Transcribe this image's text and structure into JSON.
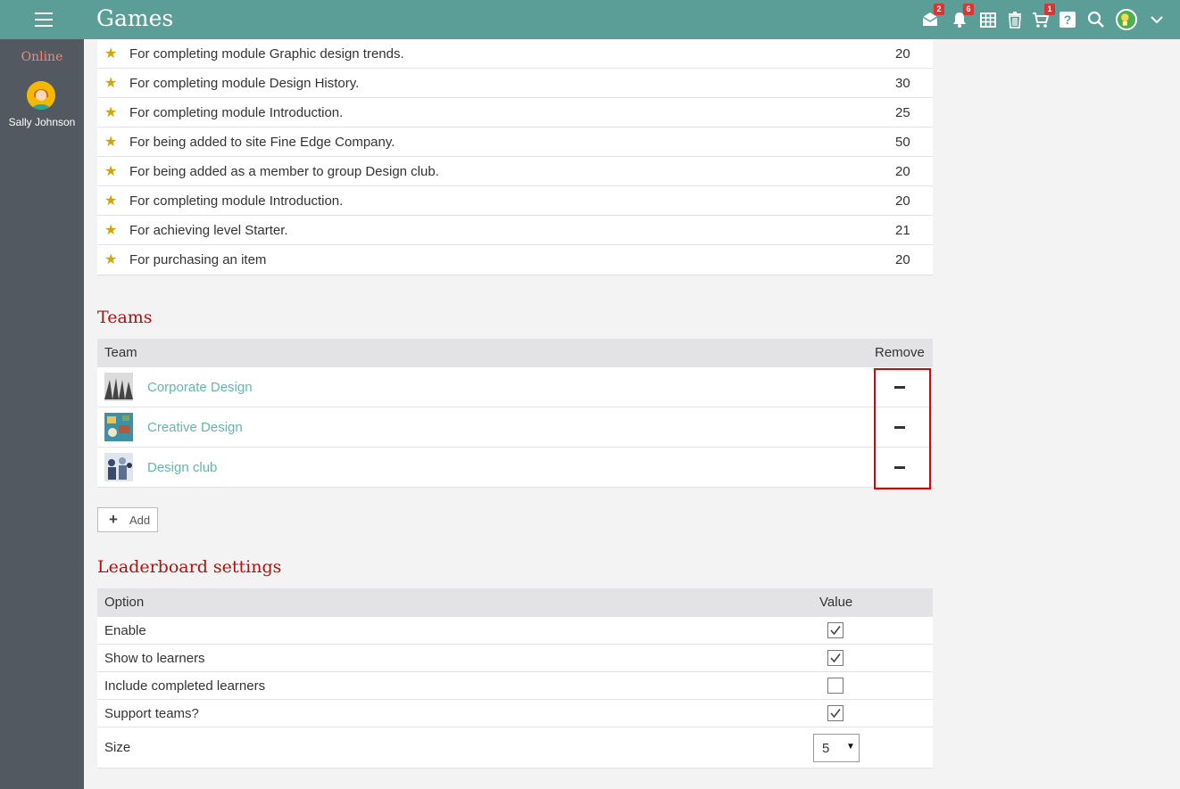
{
  "header": {
    "title": "Games",
    "badges": {
      "messages": "2",
      "notifications": "6",
      "cart": "1"
    },
    "icons": [
      "menu-icon",
      "messages-icon",
      "notifications-icon",
      "calendar-icon",
      "trash-icon",
      "cart-icon",
      "help-icon",
      "search-icon",
      "user-avatar",
      "chevron-down-icon"
    ]
  },
  "sidebar": {
    "status": "Online",
    "user_name": "Sally Johnson"
  },
  "points": [
    {
      "description": "For completing module Graphic design trends.",
      "value": "20"
    },
    {
      "description": "For completing module Design History.",
      "value": "30"
    },
    {
      "description": "For completing module Introduction.",
      "value": "25"
    },
    {
      "description": "For being added to site Fine Edge Company.",
      "value": "50"
    },
    {
      "description": "For being added as a member to group Design club.",
      "value": "20"
    },
    {
      "description": "For completing module Introduction.",
      "value": "20"
    },
    {
      "description": "For achieving level Starter.",
      "value": "21"
    },
    {
      "description": "For purchasing an item",
      "value": "20"
    }
  ],
  "teams": {
    "title": "Teams",
    "col_team": "Team",
    "col_remove": "Remove",
    "rows": [
      {
        "name": "Corporate Design"
      },
      {
        "name": "Creative Design"
      },
      {
        "name": "Design club"
      }
    ],
    "add_label": "Add"
  },
  "leaderboard": {
    "title": "Leaderboard settings",
    "col_option": "Option",
    "col_value": "Value",
    "options": [
      {
        "label": "Enable",
        "checked": true
      },
      {
        "label": "Show to learners",
        "checked": true
      },
      {
        "label": "Include completed learners",
        "checked": false
      },
      {
        "label": "Support teams?",
        "checked": true
      }
    ],
    "size_label": "Size",
    "size_value": "5"
  },
  "colors": {
    "topbar": "#5b9e98",
    "sidebar": "#525960",
    "section_title": "#b01010",
    "link": "#5fb8ad",
    "star": "#d4a500",
    "highlight": "#e00000"
  }
}
